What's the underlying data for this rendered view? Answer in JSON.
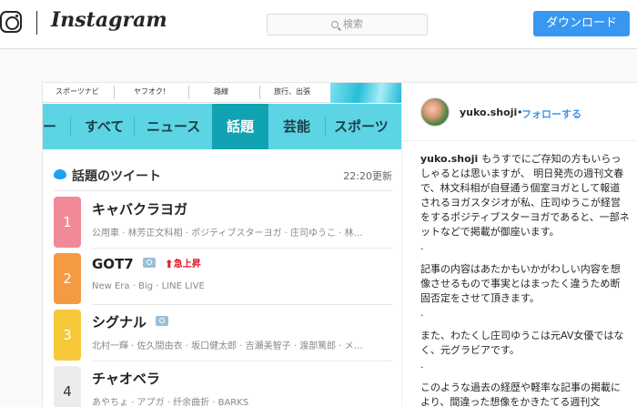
{
  "header": {
    "wordmark": "Instagram",
    "search_placeholder": "検索",
    "download_label": "ダウンロード"
  },
  "photo": {
    "subnav": [
      "スポーツナビ",
      "ヤフオク!",
      "路線",
      "旅行、出張"
    ],
    "tabs": [
      "ー",
      "すべて",
      "ニュース",
      "話題",
      "芸能",
      "スポーツ"
    ],
    "active_tab": "話題",
    "tweets_title": "話題のツイート",
    "tweets_time": "22:20更新",
    "rankings": [
      {
        "rank": "1",
        "title": "キャバクラヨガ",
        "sub": "公用車 · 林芳正文科相 · ポジティブスターヨガ · 庄司ゆうこ · 林…",
        "color": "#f08a98",
        "camera": false,
        "rising": ""
      },
      {
        "rank": "2",
        "title": "GOT7",
        "sub": "New Era · Big · LINE LIVE",
        "color": "#f49a42",
        "camera": true,
        "rising": "急上昇"
      },
      {
        "rank": "3",
        "title": "シグナル",
        "sub": "北村一輝 · 佐久間由衣 · 坂口健太郎 · 吉瀬美智子 · 渡部篤郎 · メ…",
        "color": "#f7c93a",
        "camera": true,
        "rising": ""
      },
      {
        "rank": "4",
        "title": "チャオベラ",
        "sub": "あやちょ · アプガ · 纤余曲折 · BARKS",
        "color": "#ececec",
        "camera": false,
        "rising": ""
      }
    ]
  },
  "post": {
    "username": "yuko.shoji",
    "separator": "•",
    "follow_label": "フォローする",
    "caption_user": "yuko.shoji",
    "caption_paragraphs": [
      "もうすでにご存知の方もいらっしゃるとは思いますが、 明日発売の週刊文春で、林文科相が自昼通う個室ヨガとして報道されるヨガスタジオが私、庄司ゆうこが経営をするポジティブスターヨガであると、一部ネットなどで掲載が御座います。",
      ".",
      "記事の内容はあたかもいかがわしい内容を想像させるもので事実とはまったく違うため断固否定をさせて頂きます。",
      ".",
      "また、わたくし庄司ゆうこは元AV女優ではなく、元グラビアです。",
      ".",
      "このような過去の経歴や軽率な記事の掲載により、間違った想像をかきたてる週刊文"
    ]
  }
}
